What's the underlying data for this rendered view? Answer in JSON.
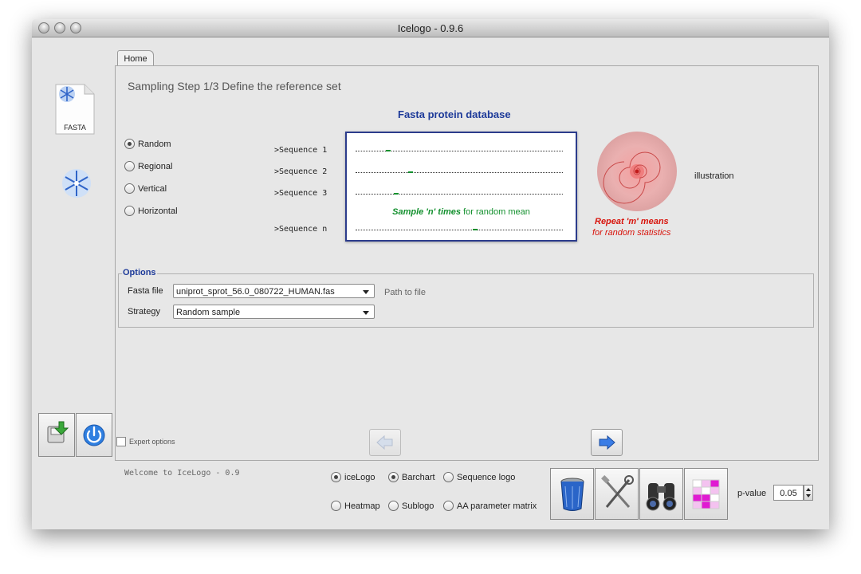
{
  "window": {
    "title": "Icelogo - 0.9.6"
  },
  "tab": {
    "home_label": "Home"
  },
  "left_icons": {
    "fasta_label": "FASTA"
  },
  "step_title": "Sampling Step 1/3 Define the reference set",
  "fasta_header": "Fasta protein database",
  "sampling_options": [
    {
      "label": "Random",
      "selected": true
    },
    {
      "label": "Regional",
      "selected": false
    },
    {
      "label": "Vertical",
      "selected": false
    },
    {
      "label": "Horizontal",
      "selected": false
    }
  ],
  "sequences": [
    ">Sequence 1",
    ">Sequence 2",
    ">Sequence 3",
    ">Sequence n"
  ],
  "sample_text": {
    "bold": "Sample 'n' times",
    "normal": " for random mean"
  },
  "illustration": {
    "label": "illustration",
    "repeat_bold": "Repeat 'm' means",
    "repeat_normal": "for random statistics"
  },
  "options": {
    "legend": "Options",
    "fasta_label": "Fasta file",
    "fasta_value": "uniprot_sprot_56.0_080722_HUMAN.fas",
    "path_label": "Path to file",
    "strategy_label": "Strategy",
    "strategy_value": "Random sample"
  },
  "expert_options": {
    "label": "Expert options",
    "checked": false
  },
  "status": {
    "welcome": "Welcome to IceLogo - 0.9"
  },
  "visualization_options": [
    {
      "label": "iceLogo",
      "selected": true
    },
    {
      "label": "Barchart",
      "selected": true
    },
    {
      "label": "Sequence logo",
      "selected": false
    },
    {
      "label": "Heatmap",
      "selected": false
    },
    {
      "label": "Sublogo",
      "selected": false
    },
    {
      "label": "AA parameter matrix",
      "selected": false
    }
  ],
  "pvalue": {
    "label": "p-value",
    "value": "0.05"
  },
  "colors": {
    "header_blue": "#1d3a99",
    "green": "#13902e",
    "red": "#d8140c"
  }
}
